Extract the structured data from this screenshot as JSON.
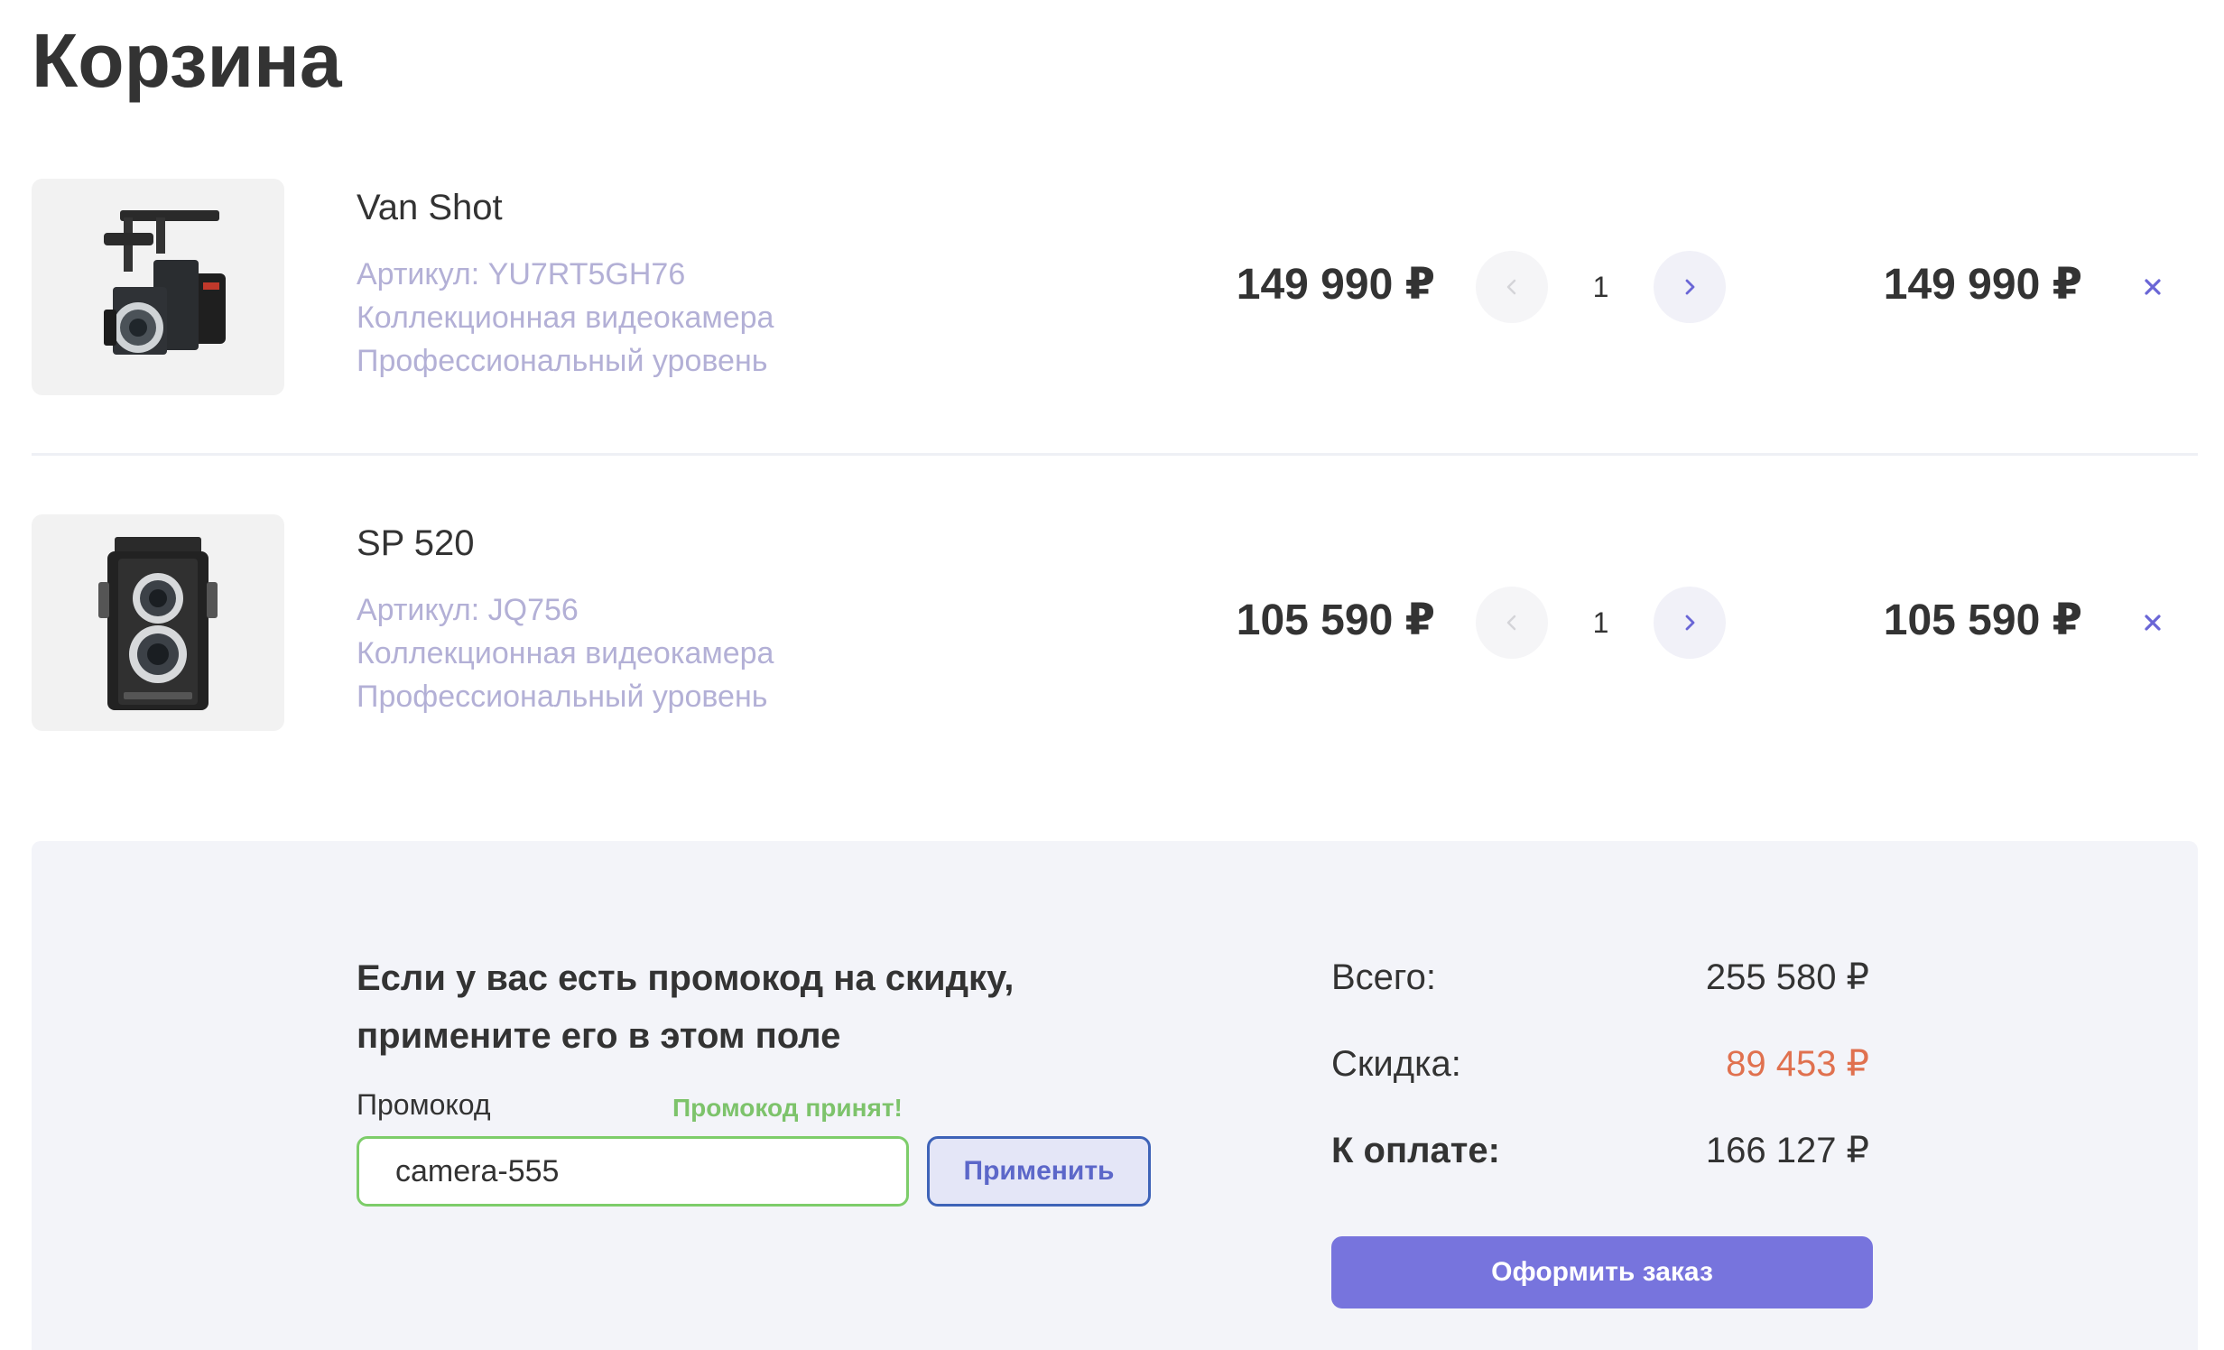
{
  "page": {
    "title": "Корзина"
  },
  "currency_symbol": "₽",
  "cart": {
    "items": [
      {
        "name": "Van Shot",
        "sku": "Артикул: YU7RT5GH76",
        "line1": "Коллекционная видеокамера",
        "line2": "Профессиональный уровень",
        "price": "149 990 ₽",
        "quantity": "1",
        "total": "149 990 ₽",
        "image_icon": "video-camera-icon"
      },
      {
        "name": "SP 520",
        "sku": "Артикул: JQ756",
        "line1": "Коллекционная видеокамера",
        "line2": "Профессиональный уровень",
        "price": "105 590 ₽",
        "quantity": "1",
        "total": "105 590 ₽",
        "image_icon": "twin-lens-camera-icon"
      }
    ]
  },
  "promo": {
    "heading": "Если у вас есть промокод на скидку, примените его в этом поле",
    "label": "Промокод",
    "status": "Промокод принят!",
    "value": "camera-555",
    "apply_label": "Применить"
  },
  "summary": {
    "total_label": "Всего:",
    "total_value": "255 580 ₽",
    "discount_label": "Скидка:",
    "discount_value": "89 453 ₽",
    "pay_label": "К оплате:",
    "pay_value": "166 127 ₽",
    "checkout_label": "Оформить заказ"
  },
  "colors": {
    "accent": "#7774dd",
    "muted_text": "#b3b0d6",
    "promo_ok": "#7dc36b",
    "discount": "#e0714f",
    "panel_bg": "#f3f4f9"
  }
}
